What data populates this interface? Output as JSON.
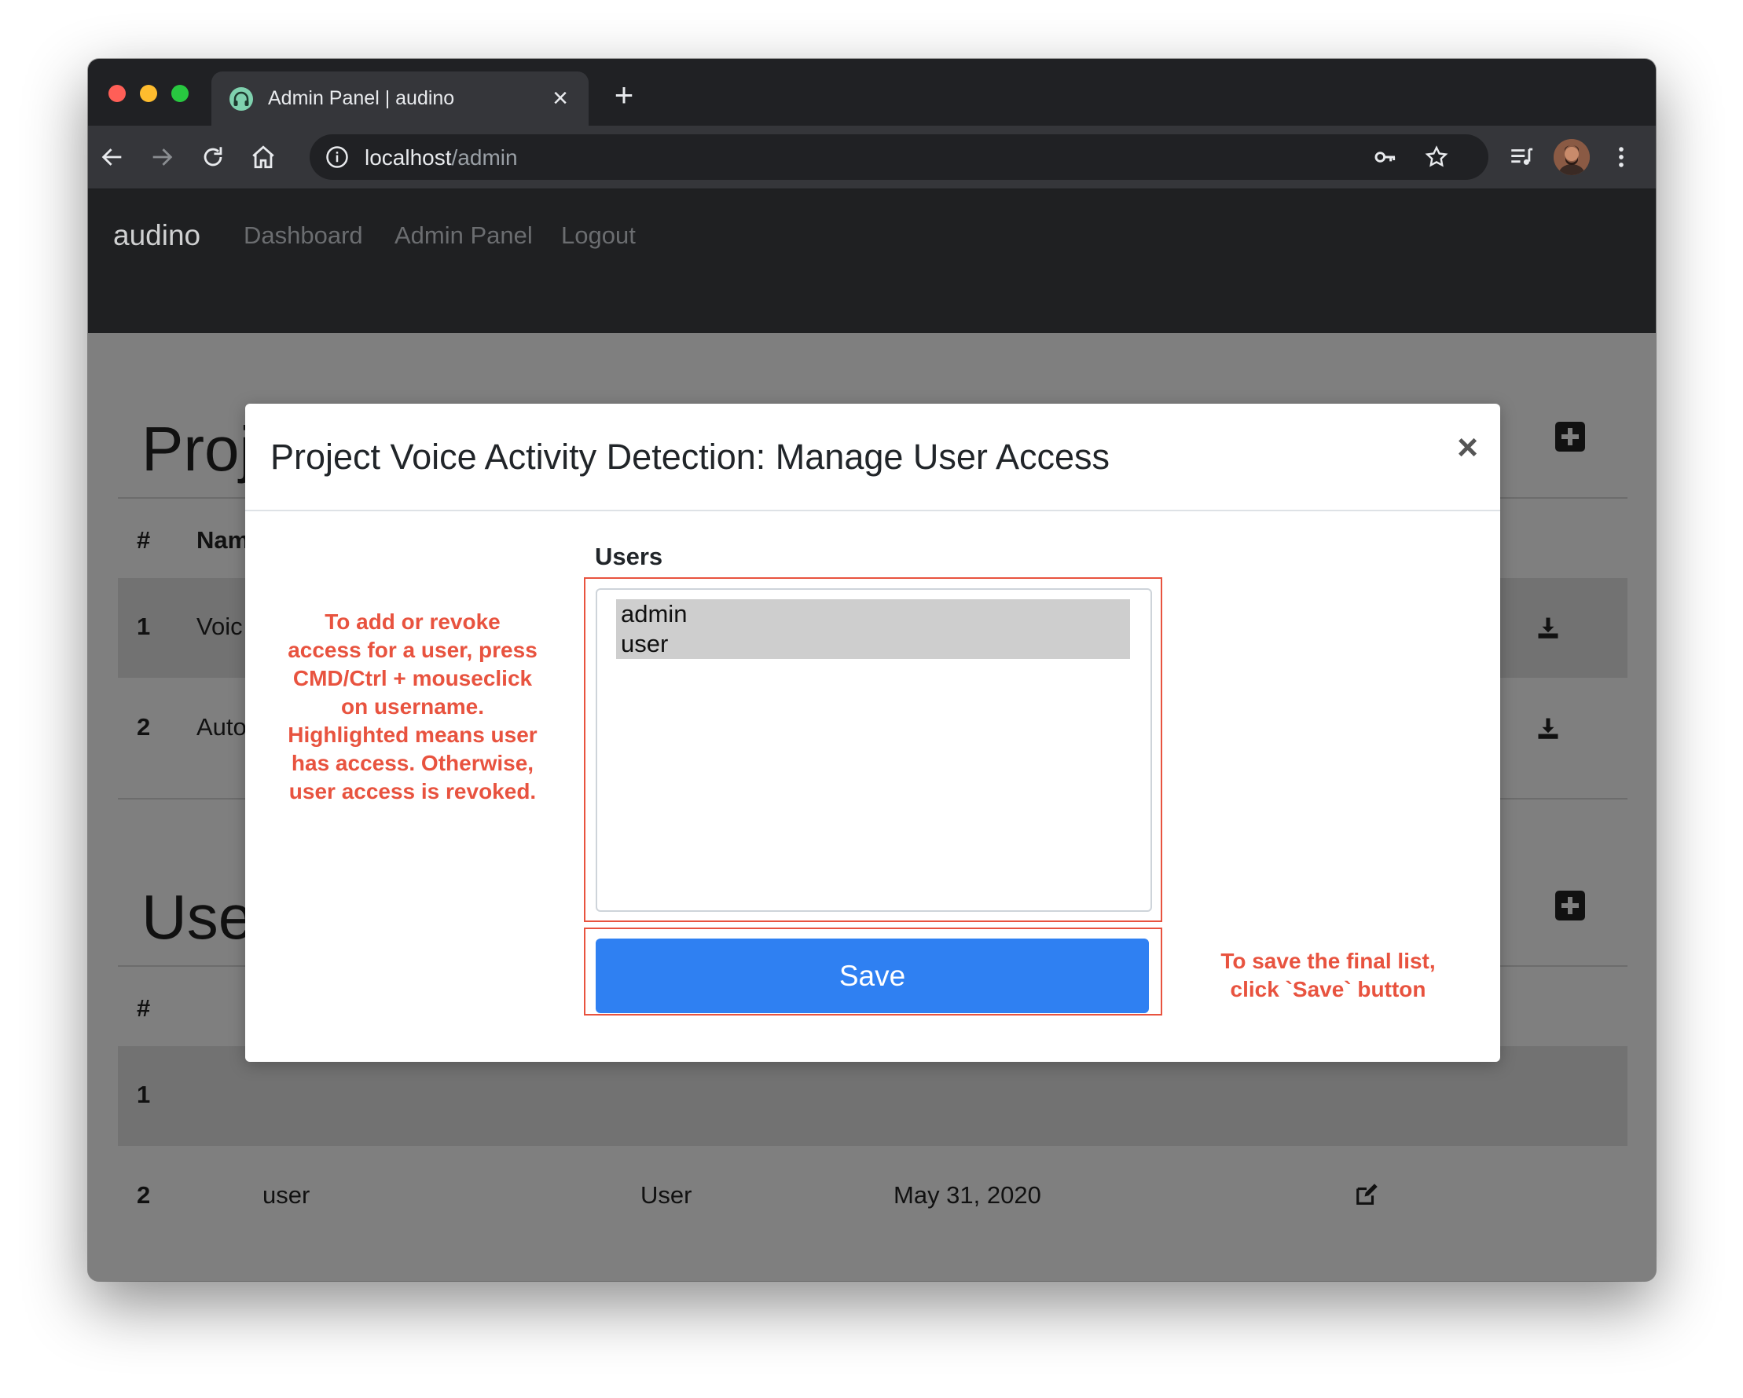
{
  "browser": {
    "tab_title": "Admin Panel | audino",
    "tab_close": "×",
    "new_tab": "+",
    "url_host": "localhost",
    "url_path": "/admin"
  },
  "navbar": {
    "brand": "audino",
    "links": [
      "Dashboard",
      "Admin Panel",
      "Logout"
    ]
  },
  "projects": {
    "heading": "Projects",
    "columns": [
      "#",
      "Nam"
    ],
    "rows": [
      {
        "id": "1",
        "name": "Voic"
      },
      {
        "id": "2",
        "name": "Auto"
      }
    ]
  },
  "users": {
    "heading": "Use",
    "columns": [
      "#"
    ],
    "rows": [
      {
        "id": "1",
        "username": "",
        "role": "",
        "created": ""
      },
      {
        "id": "2",
        "username": "user",
        "role": "User",
        "created": "May 31, 2020"
      }
    ]
  },
  "modal": {
    "title": "Project Voice Activity Detection: Manage User Access",
    "close": "×",
    "users_label": "Users",
    "options": [
      "admin",
      "user"
    ],
    "selected": [
      "admin",
      "user"
    ],
    "save_label": "Save"
  },
  "annotations": {
    "left_note": [
      "To add or revoke",
      "access for a user, press",
      "CMD/Ctrl + mouseclick",
      "on username.",
      "Highlighted means user",
      "has access. Otherwise,",
      "user access is revoked."
    ],
    "right_note": [
      "To save the final list,",
      "click `Save` button"
    ]
  },
  "colors": {
    "annotation": "#e8533f",
    "save_button": "#2f80f2",
    "overlay": "#7f7f7f"
  }
}
